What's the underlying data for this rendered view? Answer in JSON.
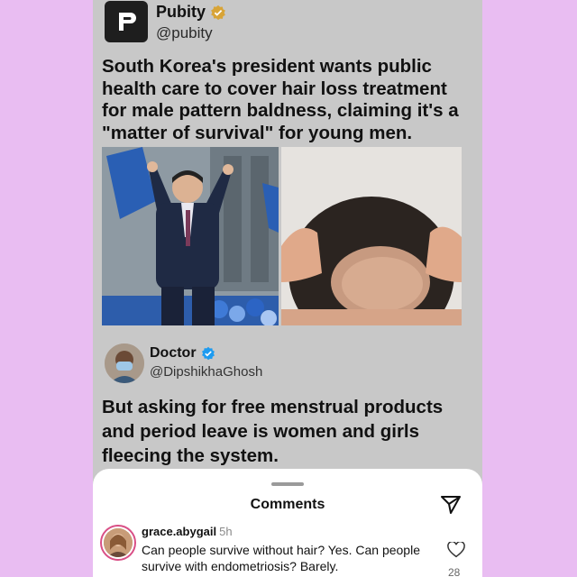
{
  "post": {
    "author": {
      "name": "Pubity",
      "handle": "@pubity",
      "verified_color": "#d8a437"
    },
    "headline": "South Korea's president wants public health care to cover hair loss treatment for male pattern baldness, claiming it's a \"matter of survival\" for young men.",
    "images": [
      {
        "icon": "photo-politician-celebrating"
      },
      {
        "icon": "photo-balding-scalp"
      }
    ]
  },
  "quoted": {
    "author": {
      "name": "Doctor",
      "handle": "@DipshikhaGhosh",
      "verified_color": "#1d9bf0"
    },
    "text": "But asking for free menstrual products and period leave is women and girls fleecing the system."
  },
  "comments_sheet": {
    "title": "Comments",
    "send_icon": "send-icon",
    "comment": {
      "username": "grace.abygail",
      "time": "5h",
      "text": "Can people survive without hair? Yes. Can people survive with endometriosis? Barely.",
      "likes": "28",
      "ring_color": "#d94f86"
    }
  },
  "colors": {
    "page_background": "#e9bdf2",
    "post_background": "#c8c8c8"
  }
}
